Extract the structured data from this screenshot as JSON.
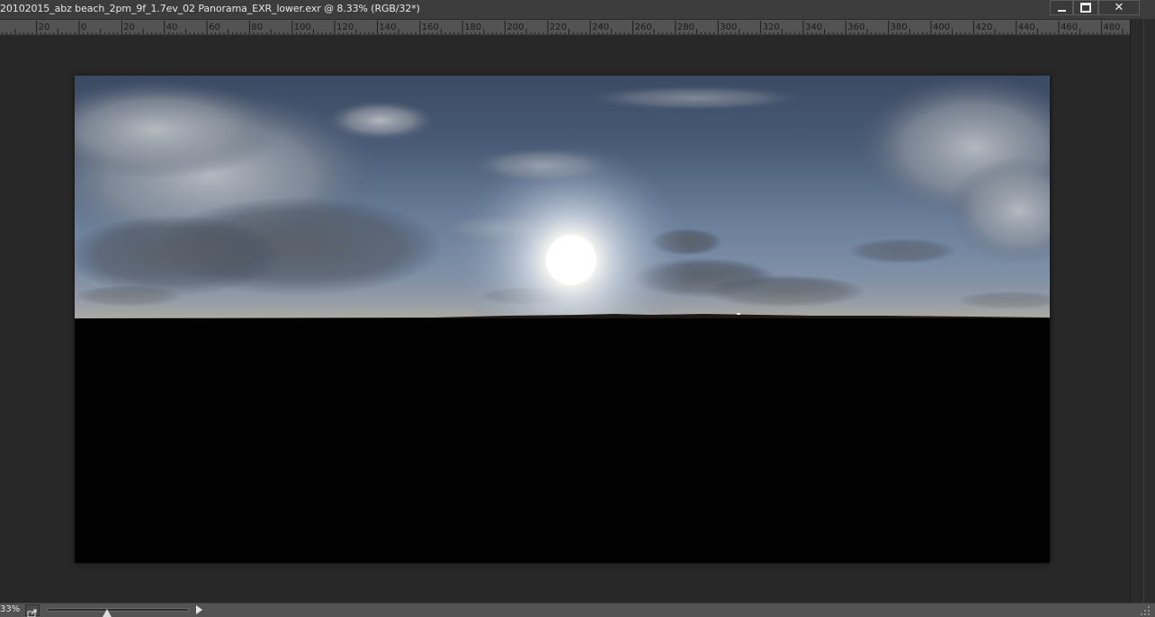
{
  "window": {
    "title": "20102015_abz beach_2pm_9f_1.7ev_02 Panorama_EXR_lower.exr @ 8.33% (RGB/32*)",
    "buttons": {
      "minimize_icon": "minimize-icon",
      "maximize_icon": "maximize-icon",
      "close_icon": "close-icon",
      "close_glyph": "✕"
    }
  },
  "ruler": {
    "labels": [
      "20",
      "0",
      "20",
      "40",
      "60",
      "80",
      "100",
      "120",
      "140",
      "160",
      "180",
      "200",
      "220",
      "240",
      "260",
      "280",
      "300",
      "320",
      "340",
      "360",
      "380",
      "400",
      "420",
      "440",
      "460",
      "480"
    ]
  },
  "document": {
    "content": "HDR panorama image: cloudy sky with bright sun above horizon, lower half black",
    "colors": {
      "sky_top": "#3b4a63",
      "sky_horizon": "#8a93a0",
      "sun": "#ffffff",
      "ground": "#020202",
      "workspace": "#282828"
    }
  },
  "statusbar": {
    "zoom": "33%",
    "export_icon": "export-icon",
    "slider_position": 0.42,
    "next_icon": "play-arrow-icon"
  }
}
